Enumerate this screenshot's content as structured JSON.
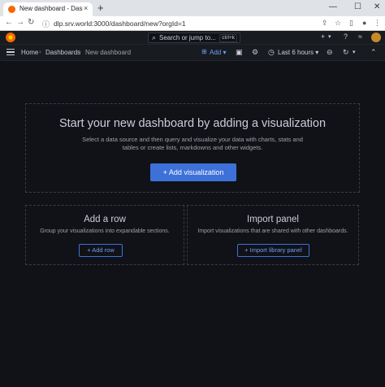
{
  "browser": {
    "tab_title": "New dashboard - Dashboards - ",
    "tab_close": "×",
    "new_tab": "+",
    "url": "dlp.srv.world:3000/dashboard/new?orgId=1",
    "window_min": "—",
    "window_max": "☐",
    "window_close": "✕"
  },
  "topbar": {
    "search_placeholder": "Search or jump to...",
    "search_shortcut": "ctrl+k",
    "plus": "+",
    "plus_caret": "▾"
  },
  "breadcrumb": {
    "home": "Home",
    "dashboards": "Dashboards",
    "current": "New dashboard",
    "separator": "›"
  },
  "toolbar": {
    "add_label": "Add",
    "time_range": "Last 6 hours"
  },
  "empty_state": {
    "title": "Start your new dashboard by adding a visualization",
    "description": "Select a data source and then query and visualize your data with charts, stats and tables or create lists, markdowns and other widgets.",
    "button": "+ Add visualization"
  },
  "add_row": {
    "title": "Add a row",
    "description": "Group your visualizations into expandable sections.",
    "button": "+ Add row"
  },
  "import_panel": {
    "title": "Import panel",
    "description": "Import visualizations that are shared with other dashboards.",
    "button": "+ Import library panel"
  },
  "colors": {
    "background": "#111217",
    "primary": "#3d71d9",
    "grafana_orange": "#f46800"
  }
}
